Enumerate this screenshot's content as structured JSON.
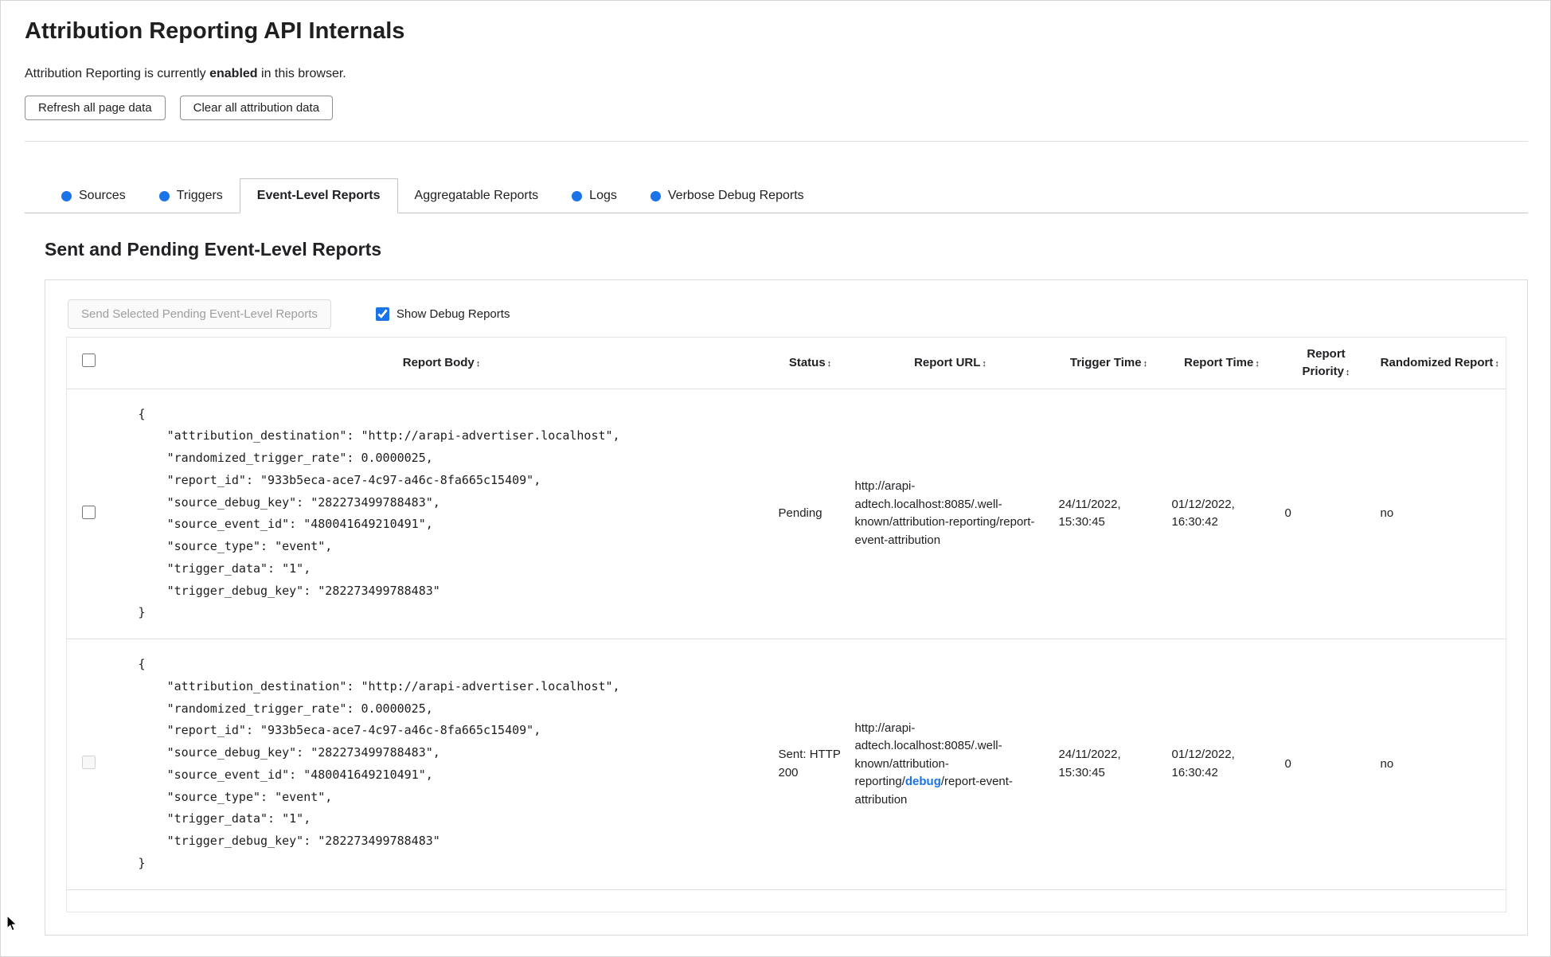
{
  "page": {
    "title": "Attribution Reporting API Internals",
    "status_prefix": "Attribution Reporting is currently ",
    "status_bold": "enabled",
    "status_suffix": " in this browser.",
    "refresh_button": "Refresh all page data",
    "clear_button": "Clear all attribution data"
  },
  "colors": {
    "accent_blue": "#1a73e8",
    "border_gray": "#dcdcdc",
    "disabled_text": "#9e9e9e"
  },
  "tabs": [
    {
      "label": "Sources",
      "has_dot": true,
      "active": false
    },
    {
      "label": "Triggers",
      "has_dot": true,
      "active": false
    },
    {
      "label": "Event-Level Reports",
      "has_dot": false,
      "active": true
    },
    {
      "label": "Aggregatable Reports",
      "has_dot": false,
      "active": false
    },
    {
      "label": "Logs",
      "has_dot": true,
      "active": false
    },
    {
      "label": "Verbose Debug Reports",
      "has_dot": true,
      "active": false
    }
  ],
  "section": {
    "heading": "Sent and Pending Event-Level Reports",
    "send_button": "Send Selected Pending Event-Level Reports",
    "send_button_disabled": true,
    "show_debug_label": "Show Debug Reports",
    "show_debug_checked": true
  },
  "table": {
    "sort_icon": "↕",
    "headers": [
      "Report Body",
      "Status",
      "Report URL",
      "Trigger Time",
      "Report Time",
      "Report Priority",
      "Randomized Report"
    ],
    "rows": [
      {
        "checkbox_disabled": false,
        "body": "{\n    \"attribution_destination\": \"http://arapi-advertiser.localhost\",\n    \"randomized_trigger_rate\": 0.0000025,\n    \"report_id\": \"933b5eca-ace7-4c97-a46c-8fa665c15409\",\n    \"source_debug_key\": \"282273499788483\",\n    \"source_event_id\": \"480041649210491\",\n    \"source_type\": \"event\",\n    \"trigger_data\": \"1\",\n    \"trigger_debug_key\": \"282273499788483\"\n}",
        "status": "Pending",
        "url_before": "http://arapi-adtech.localhost:8085/.well-known/attribution-reporting/report-event-attribution",
        "url_link": "",
        "url_after": "",
        "trigger_time": "24/11/2022, 15:30:45",
        "report_time": "01/12/2022, 16:30:42",
        "priority": "0",
        "randomized": "no"
      },
      {
        "checkbox_disabled": true,
        "body": "{\n    \"attribution_destination\": \"http://arapi-advertiser.localhost\",\n    \"randomized_trigger_rate\": 0.0000025,\n    \"report_id\": \"933b5eca-ace7-4c97-a46c-8fa665c15409\",\n    \"source_debug_key\": \"282273499788483\",\n    \"source_event_id\": \"480041649210491\",\n    \"source_type\": \"event\",\n    \"trigger_data\": \"1\",\n    \"trigger_debug_key\": \"282273499788483\"\n}",
        "status": "Sent: HTTP 200",
        "url_before": "http://arapi-adtech.localhost:8085/.well-known/attribution-reporting/",
        "url_link": "debug",
        "url_after": "/report-event-attribution",
        "trigger_time": "24/11/2022, 15:30:45",
        "report_time": "01/12/2022, 16:30:42",
        "priority": "0",
        "randomized": "no"
      }
    ]
  }
}
